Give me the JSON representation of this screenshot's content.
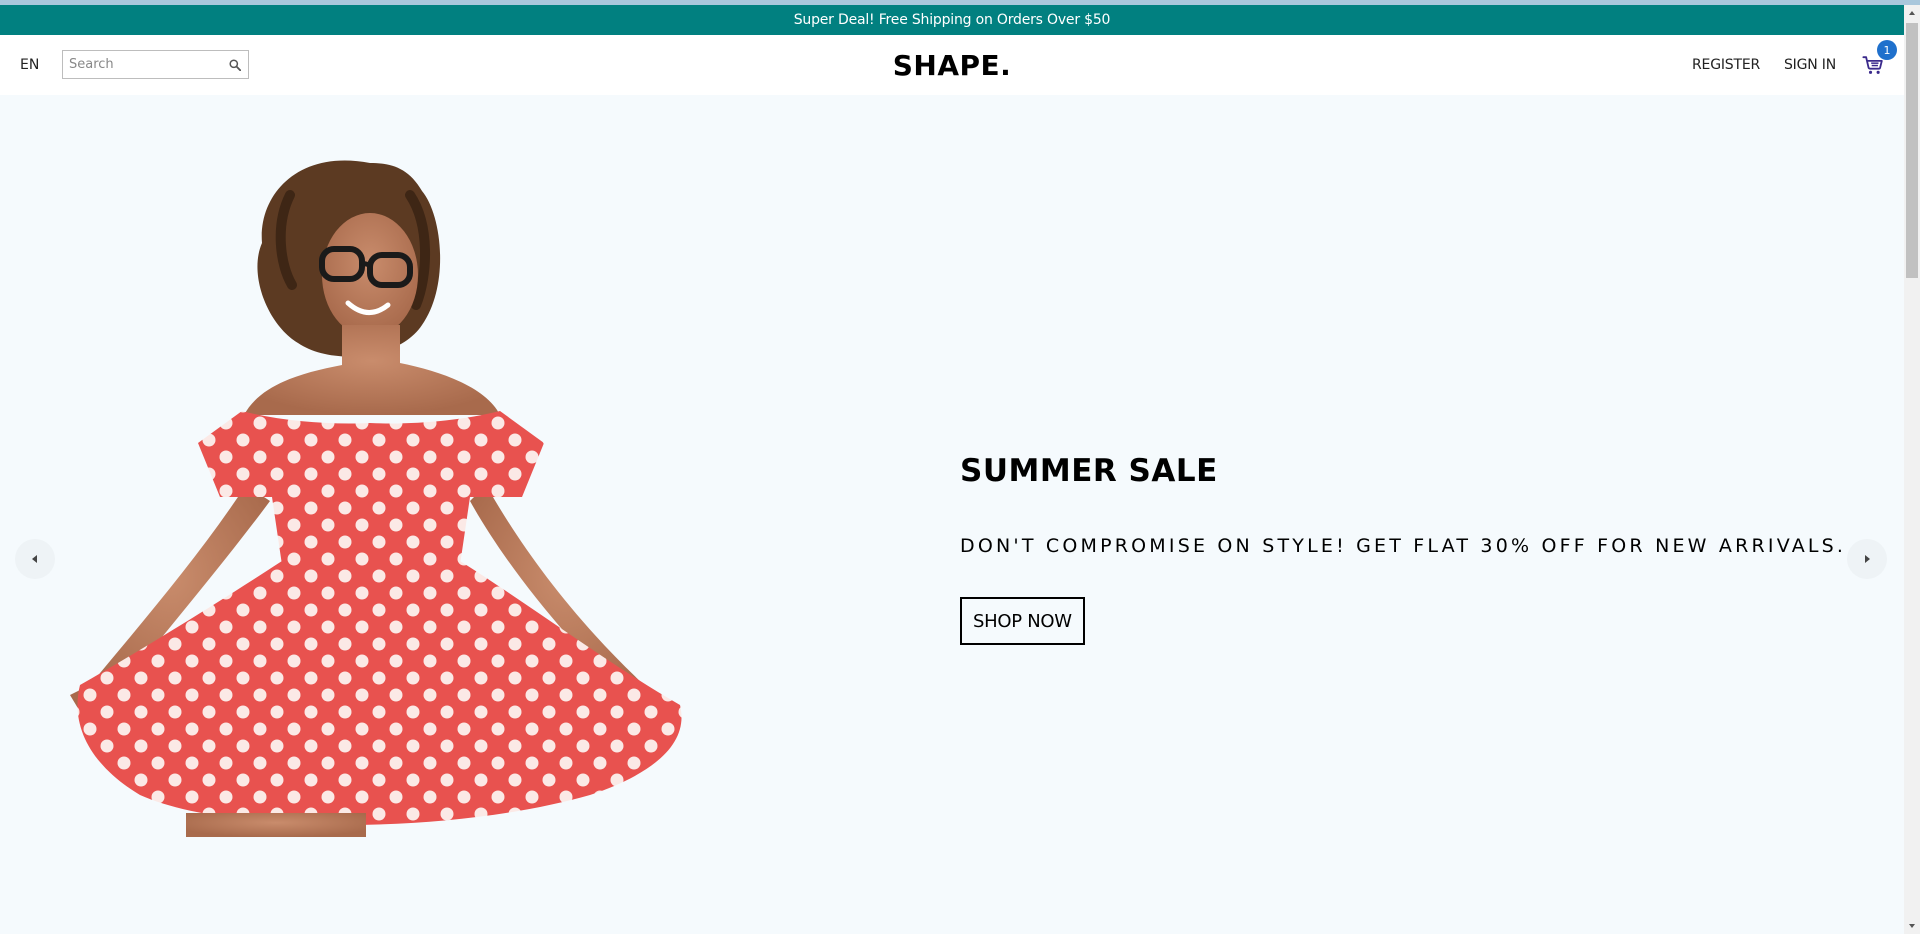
{
  "announcement": {
    "text": "Super Deal! Free Shipping on Orders Over $50",
    "background": "#018080"
  },
  "navbar": {
    "language": "EN",
    "search": {
      "placeholder": "Search",
      "value": "",
      "icon": "search-icon"
    },
    "logo": "SHAPE.",
    "register_label": "REGISTER",
    "signin_label": "SIGN IN",
    "cart": {
      "icon": "cart-icon",
      "count": "1",
      "badge_color": "#1f70cc"
    }
  },
  "hero": {
    "background": "#f5fafd",
    "image": "woman-in-red-polka-dot-dress",
    "title": "SUMMER SALE",
    "subtitle": "DON'T COMPROMISE ON STYLE! GET FLAT 30% OFF FOR NEW ARRIVALS.",
    "button_label": "SHOP NOW",
    "prev_icon": "arrow-left-icon",
    "next_icon": "arrow-right-icon"
  }
}
